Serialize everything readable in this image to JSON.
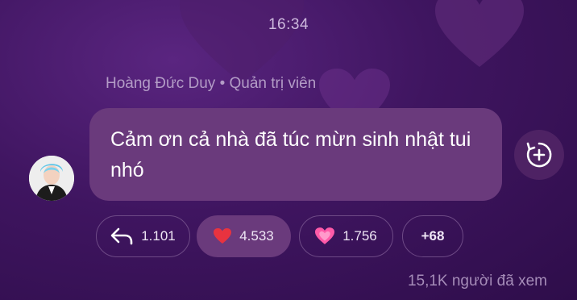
{
  "header": {
    "time": "16:34"
  },
  "message": {
    "sender_name": "Hoàng Đức Duy",
    "sender_role": "Quản trị viên",
    "text": "Cảm ơn cả nhà đã túc mừn sinh nhật tui nhó"
  },
  "reactions": {
    "reply": {
      "icon": "reply-arrow-icon",
      "count": "1.101"
    },
    "heart": {
      "icon": "red-heart-emoji",
      "emoji": "❤️",
      "count": "4.533"
    },
    "sparkle_heart": {
      "icon": "sparkling-heart-emoji",
      "emoji": "💗",
      "count": "1.756"
    },
    "more": {
      "label": "+68"
    }
  },
  "footer": {
    "views": "15,1K người đã xem"
  },
  "colors": {
    "background": "#3f1560",
    "bubble": "#6a3a7c",
    "pill_border": "#6e4a86",
    "heart_red": "#e8333f",
    "heart_pink": "#ff5aa8"
  }
}
